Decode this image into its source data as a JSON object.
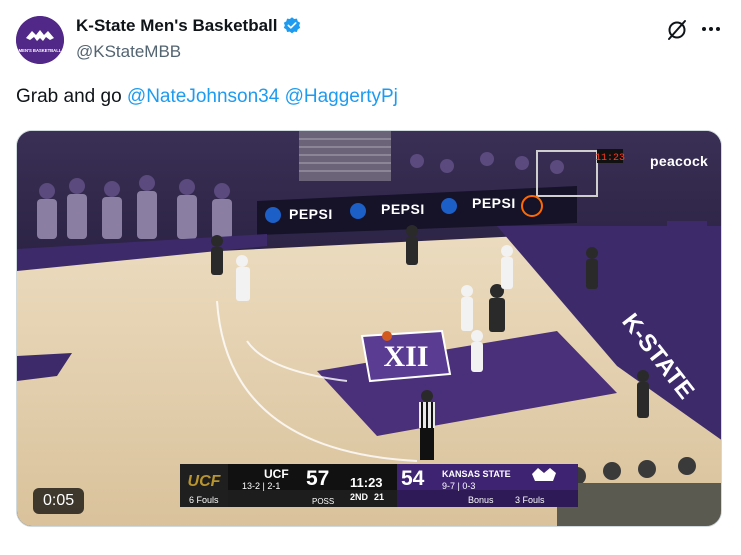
{
  "author": {
    "display_name": "K-State Men's Basketball",
    "handle": "@KStateMBB",
    "avatar_text": "MEN'S BASKETBALL"
  },
  "tweet": {
    "text": "Grab and go ",
    "mentions": [
      "@NateJohnson34",
      "@HaggertyPj"
    ]
  },
  "video": {
    "timestamp": "0:05",
    "network": "peacock",
    "ads": [
      "PEPSI",
      "PEPSI",
      "PEPSI"
    ],
    "floor_text": "K-STATE",
    "scorebug": {
      "away_team": "UCF",
      "away_record": "13-2 | 2-1",
      "away_score": "57",
      "away_fouls": "6 Fouls",
      "clock": "11:23",
      "half": "2ND",
      "shot_clock": "21",
      "poss": "POSS",
      "home_score": "54",
      "home_team": "KANSAS STATE",
      "home_record": "9-7 | 0-3",
      "bonus": "Bonus",
      "home_fouls": "3 Fouls",
      "board_time": "11:23"
    }
  },
  "colors": {
    "kstate_purple": "#512888",
    "link_blue": "#1d9bf0",
    "verified_blue": "#1d9bf0",
    "ucf_gold": "#b8952e"
  },
  "icons": {
    "verified": "verified-badge-icon",
    "grok": "grok-icon",
    "more": "more-horizontal-icon"
  }
}
